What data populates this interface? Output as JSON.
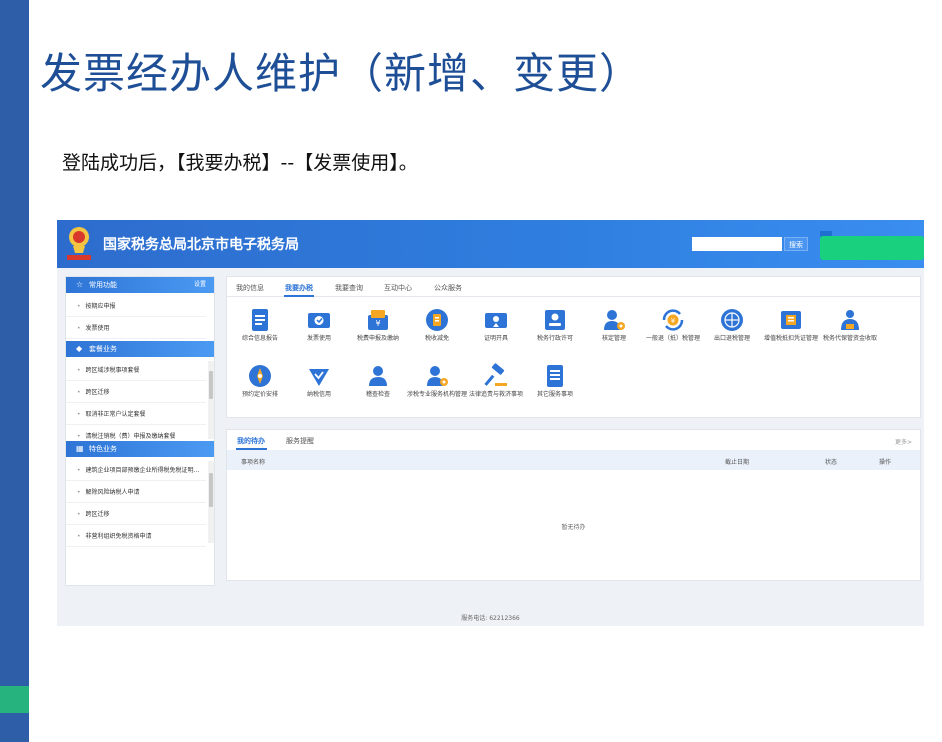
{
  "slide": {
    "title": "发票经办人维护（新增、变更）",
    "subtitle": "登陆成功后，【我要办税】--【发票使用】。"
  },
  "colors": {
    "slide_bar": "#2e5ea8",
    "slide_bar_accent": "#27b37e",
    "header_blue": "#2f7fe0",
    "active_blue": "#2e74d6",
    "badge_green": "#19d07f",
    "icon_orange": "#f5a623"
  },
  "header": {
    "site_title": "国家税务总局北京市电子税务局",
    "emblem_caption": "中国税务",
    "search_placeholder": "",
    "search_button": "搜索"
  },
  "sidebar": {
    "sections": [
      {
        "title": "常用功能",
        "icon": "star-icon",
        "action": "设置",
        "items": [
          "按期应申报",
          "发票使用"
        ]
      },
      {
        "title": "套餐业务",
        "icon": "package-icon",
        "items": [
          "跨区域涉税事项套餐",
          "跨区迁移",
          "取消非正常户认定套餐",
          "清税注销税（费）申报及缴纳套餐"
        ]
      },
      {
        "title": "特色业务",
        "icon": "grid-icon",
        "items": [
          "建筑企业项目部预缴企业所得税免税证明...",
          "解除风险纳税人申请",
          "跨区迁移",
          "非营利组织免税资格申请"
        ]
      }
    ]
  },
  "main": {
    "tabs": [
      "我的信息",
      "我要办税",
      "我要查询",
      "互动中心",
      "公众服务"
    ],
    "active_tab": "我要办税",
    "services": [
      {
        "label": "综合信息报告",
        "icon": "document-icon"
      },
      {
        "label": "发票使用",
        "icon": "invoice-icon"
      },
      {
        "label": "税费申报及缴纳",
        "icon": "tax-declare-icon"
      },
      {
        "label": "税收减免",
        "icon": "tax-reduction-icon"
      },
      {
        "label": "证明开具",
        "icon": "certificate-icon"
      },
      {
        "label": "税务行政许可",
        "icon": "license-icon"
      },
      {
        "label": "核定管理",
        "icon": "person-gear-icon"
      },
      {
        "label": "一般退（抵）税管理",
        "icon": "refund-icon"
      },
      {
        "label": "出口退税管理",
        "icon": "globe-icon"
      },
      {
        "label": "增值税抵扣凭证管理",
        "icon": "voucher-icon"
      },
      {
        "label": "税务代保管资金收取",
        "icon": "money-bag-icon"
      },
      {
        "label": "预约定价安排",
        "icon": "compass-icon"
      },
      {
        "label": "纳税信用",
        "icon": "credit-icon"
      },
      {
        "label": "稽查检查",
        "icon": "inspector-icon"
      },
      {
        "label": "涉税专业服务机构管理",
        "icon": "agency-icon"
      },
      {
        "label": "法律追责与救济事项",
        "icon": "gavel-icon"
      },
      {
        "label": "其它服务事项",
        "icon": "list-icon"
      }
    ]
  },
  "tasks": {
    "tabs": [
      "我的待办",
      "服务提醒"
    ],
    "active_tab": "我的待办",
    "more": "更多>",
    "columns": [
      "事项名称",
      "截止日期",
      "状态",
      "操作"
    ],
    "empty_message": "暂无待办"
  },
  "footer": {
    "hotline": "服务电话: 62212366"
  }
}
